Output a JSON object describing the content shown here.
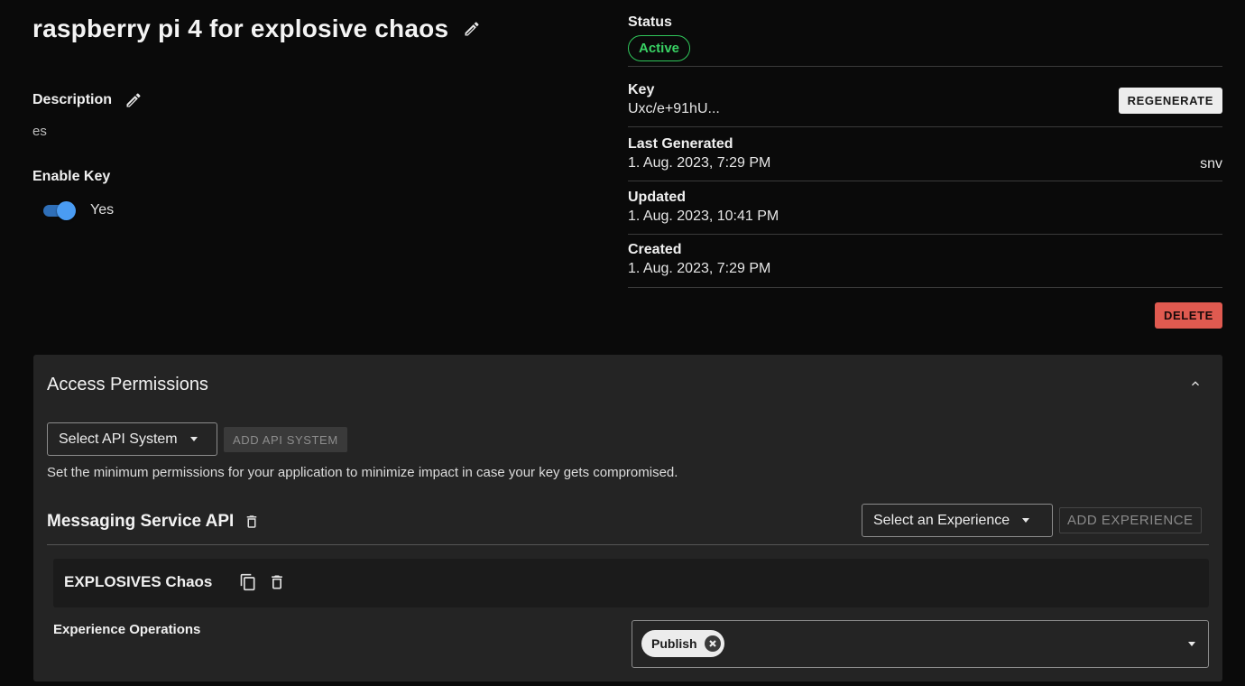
{
  "key": {
    "title": "raspberry pi 4 for explosive chaos",
    "description_label": "Description",
    "description_value": "es",
    "enable_label": "Enable Key",
    "enable_value": "Yes",
    "enabled": true
  },
  "info": {
    "status_label": "Status",
    "status_value": "Active",
    "key_label": "Key",
    "key_value": "Uxc/e+91hU...",
    "regenerate_label": "REGENERATE",
    "last_generated_label": "Last Generated",
    "last_generated_value": "1. Aug. 2023, 7:29 PM",
    "last_generated_by": "snv",
    "updated_label": "Updated",
    "updated_value": "1. Aug. 2023, 10:41 PM",
    "created_label": "Created",
    "created_value": "1. Aug. 2023, 7:29 PM",
    "delete_label": "DELETE"
  },
  "permissions": {
    "title": "Access Permissions",
    "select_api_label": "Select API System",
    "add_api_label": "ADD API SYSTEM",
    "hint": "Set the minimum permissions for your application to minimize impact in case your key gets compromised.",
    "api": {
      "name": "Messaging Service API",
      "select_experience_label": "Select an Experience",
      "add_experience_label": "ADD EXPERIENCE",
      "experience": {
        "name": "EXPLOSIVES Chaos",
        "operations_label": "Experience Operations",
        "operations": [
          "Publish"
        ]
      }
    }
  },
  "colors": {
    "background": "#0a0a0a",
    "panel": "#242424",
    "status_active": "#39d264",
    "toggle_on": "#4a9cf3",
    "delete": "#e05a50"
  },
  "icons": [
    "edit-pencil-icon",
    "chevron-up-icon",
    "trash-icon",
    "copy-icon",
    "close-circle-icon",
    "caret-down-icon"
  ]
}
